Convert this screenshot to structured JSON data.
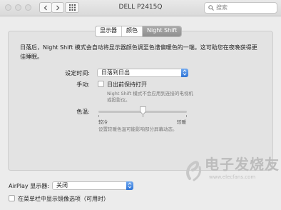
{
  "window": {
    "title": "DELL P2415Q",
    "search_placeholder": "搜索"
  },
  "tabs": [
    {
      "label": "显示器",
      "active": false
    },
    {
      "label": "颜色",
      "active": false
    },
    {
      "label": "Night Shift",
      "active": true
    }
  ],
  "description": "日落后，Night Shift 模式会自动将显示器颜色调至色谱偏暖色的一端。这可助您在夜晚获得更佳睡眠。",
  "schedule": {
    "label": "设定时间:",
    "value": "日落到日出"
  },
  "manual": {
    "label": "手动:",
    "checkbox_label": "日出前保持打开",
    "checked": false,
    "note_line1": "Night Shift 模式不会应用到连接的电视机",
    "note_line2": "或投影仪。"
  },
  "color_temp": {
    "label": "色温:",
    "min_label": "较冷",
    "max_label": "较暖",
    "level": 0.5,
    "note": "设置较暖色温可能影响部分屏幕动态。"
  },
  "airplay": {
    "label": "AirPlay 显示器:",
    "value": "关闭"
  },
  "mirroring": {
    "checkbox_label": "在菜单栏中显示镜像选项（可用时）",
    "checked": false
  },
  "watermark": {
    "text": "电子发烧友",
    "sub": "www.elecfans.com"
  },
  "colors": {
    "accent": "#2e74d6",
    "tab_active": "#9a9a9a"
  }
}
